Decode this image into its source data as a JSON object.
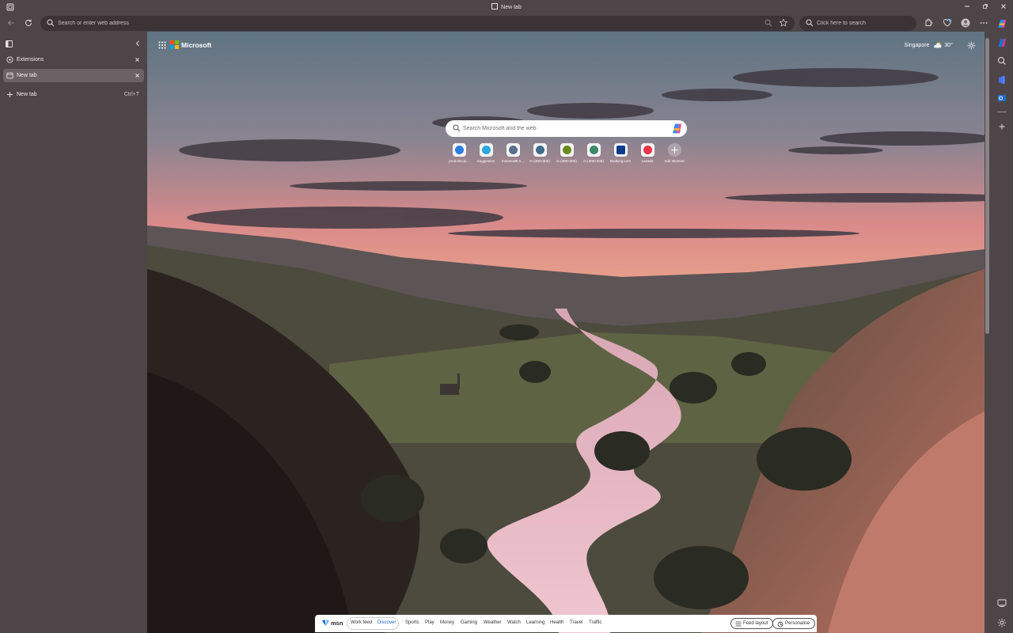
{
  "window": {
    "title": "New tab"
  },
  "toolbar": {
    "address_placeholder": "Search or enter web address",
    "search_placeholder": "Click here to search"
  },
  "sidebar": {
    "items": [
      {
        "label": "Extensions",
        "active": false
      },
      {
        "label": "New tab",
        "active": true
      }
    ],
    "new_tab": {
      "label": "New tab",
      "shortcut": "Ctrl+T"
    }
  },
  "ntp": {
    "brand": "Microsoft",
    "weather": {
      "city": "Singapore",
      "temp": "30°"
    },
    "search_placeholder": "Search Microsoft and the web",
    "shortcuts": [
      {
        "label": "prod.dev.pi...",
        "color": "#2b7de0"
      },
      {
        "label": "Suggestion",
        "color": "#2ba8e0"
      },
      {
        "label": "monmodB A...",
        "color": "#5a6f8a"
      },
      {
        "label": "m (300×300)",
        "color": "#3f6b8a"
      },
      {
        "label": "m (300×300)",
        "color": "#6b8a1e"
      },
      {
        "label": "m (300×300)",
        "color": "#3f8a6b"
      },
      {
        "label": "Booking.com",
        "color": "#0b3b8c"
      },
      {
        "label": "Lazada",
        "color": "#e8334a"
      },
      {
        "label": "Add shortcut",
        "color": "#888888"
      }
    ]
  },
  "msn": {
    "logo": "msn",
    "tabs": [
      "Work feed",
      "Discover"
    ],
    "active_tab": "Discover",
    "nav": [
      "Sports",
      "Play",
      "Money",
      "Gaming",
      "Weather",
      "Watch",
      "Learning",
      "Health",
      "Travel",
      "Traffic"
    ],
    "feed_layout": "Feed layout",
    "personalise": "Personalise"
  }
}
